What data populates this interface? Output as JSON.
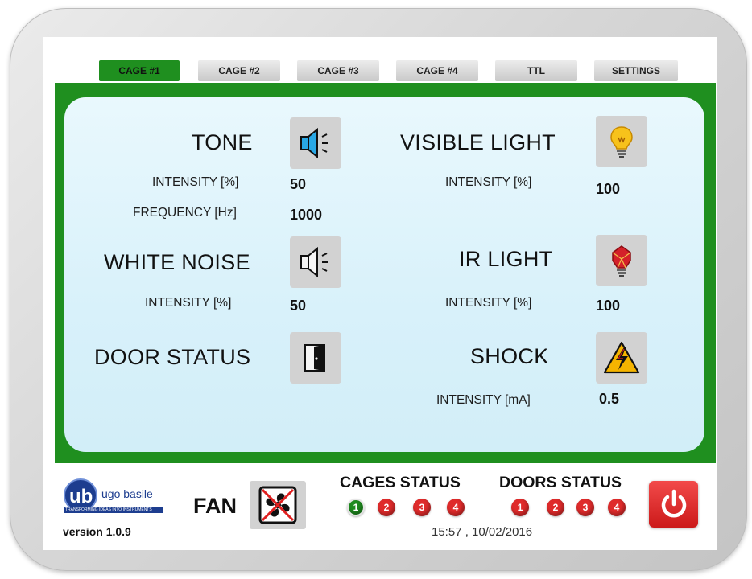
{
  "tabs": [
    "CAGE #1",
    "CAGE #2",
    "CAGE #3",
    "CAGE #4",
    "TTL",
    "SETTINGS"
  ],
  "active_tab": "CAGE #1",
  "tone": {
    "title": "TONE",
    "intensity_label": "INTENSITY [%]",
    "intensity_value": "50",
    "frequency_label": "FREQUENCY [Hz]",
    "frequency_value": "1000",
    "icon": "speaker-blue-icon"
  },
  "white_noise": {
    "title": "WHITE NOISE",
    "intensity_label": "INTENSITY [%]",
    "intensity_value": "50",
    "icon": "speaker-icon"
  },
  "door": {
    "title": "DOOR STATUS",
    "icon": "door-icon"
  },
  "visible_light": {
    "title": "VISIBLE LIGHT",
    "intensity_label": "INTENSITY [%]",
    "intensity_value": "100",
    "icon": "lightbulb-yellow-icon"
  },
  "ir_light": {
    "title": "IR LIGHT",
    "intensity_label": "INTENSITY [%]",
    "intensity_value": "100",
    "icon": "lightbulb-red-icon"
  },
  "shock": {
    "title": "SHOCK",
    "intensity_label": "INTENSITY [mA]",
    "intensity_value": "0.5",
    "icon": "high-voltage-icon"
  },
  "footer": {
    "logo_text": "ugo basile",
    "logo_tagline": "TRANSFORMING IDEAS INTO INSTRUMENTS",
    "version": "version 1.0.9",
    "fan_label": "FAN",
    "cages_status_title": "CAGES STATUS",
    "doors_status_title": "DOORS STATUS",
    "cages": [
      "1",
      "2",
      "3",
      "4"
    ],
    "cages_colors": [
      "#1f8c1f",
      "#df2b2b",
      "#df2b2b",
      "#df2b2b"
    ],
    "doors": [
      "1",
      "2",
      "3",
      "4"
    ],
    "datetime": "15:57 , 10/02/2016"
  },
  "colors": {
    "accent_green": "#1f8f1f",
    "panel_bg": "#dff4fb",
    "alert_red": "#df2b2b"
  }
}
